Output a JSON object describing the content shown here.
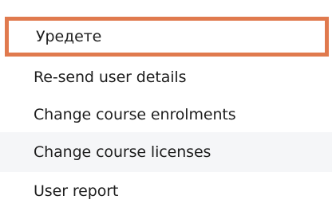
{
  "menu": {
    "items": [
      {
        "label": "Уредете",
        "selected": true
      },
      {
        "label": "Re-send user details",
        "selected": false
      },
      {
        "label": "Change course enrolments",
        "selected": false
      },
      {
        "label": "Change course licenses",
        "selected": false
      },
      {
        "label": "User report",
        "selected": false
      }
    ]
  },
  "colors": {
    "highlight_border": "#e07a4e",
    "hover_background": "#f5f6f8",
    "text": "#1e1e1e"
  }
}
